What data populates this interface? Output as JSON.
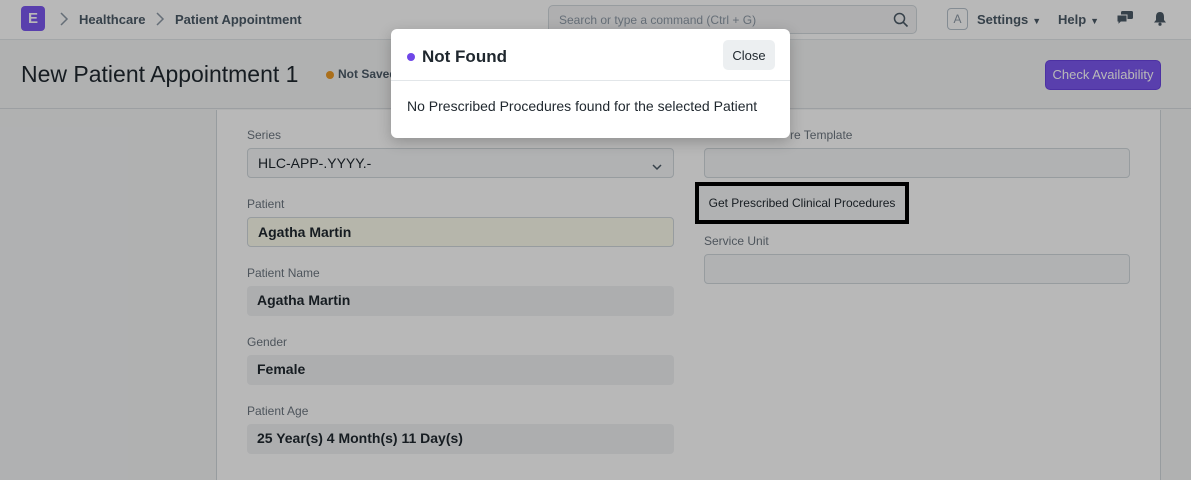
{
  "navbar": {
    "logo_letter": "E",
    "breadcrumbs": [
      "Healthcare",
      "Patient Appointment"
    ],
    "search_placeholder": "Search or type a command (Ctrl + G)",
    "avatar_letter": "A",
    "settings_label": "Settings",
    "help_label": "Help",
    "icons": [
      "search-icon",
      "chat-icon",
      "bell-icon"
    ]
  },
  "page": {
    "title": "New Patient Appointment 1",
    "status": "Not Saved",
    "status_color": "#ec9a26",
    "primary_action": "Check Availability",
    "accent_color": "#7c58f0"
  },
  "form": {
    "series": {
      "label": "Series",
      "value": "HLC-APP-.YYYY.-"
    },
    "patient": {
      "label": "Patient",
      "value": "Agatha Martin"
    },
    "patient_name": {
      "label": "Patient Name",
      "value": "Agatha Martin"
    },
    "gender": {
      "label": "Gender",
      "value": "Female"
    },
    "patient_age": {
      "label": "Patient Age",
      "value": "25 Year(s) 4 Month(s) 11 Day(s)"
    },
    "procedure_template": {
      "label": "Clinical Procedure Template",
      "visible_label": "re Template",
      "value": ""
    },
    "get_procedures_button": "Get Prescribed Clinical Procedures",
    "service_unit": {
      "label": "Service Unit",
      "value": ""
    }
  },
  "modal": {
    "title": "Not Found",
    "close_label": "Close",
    "message": "No Prescribed Procedures found for the selected Patient"
  }
}
